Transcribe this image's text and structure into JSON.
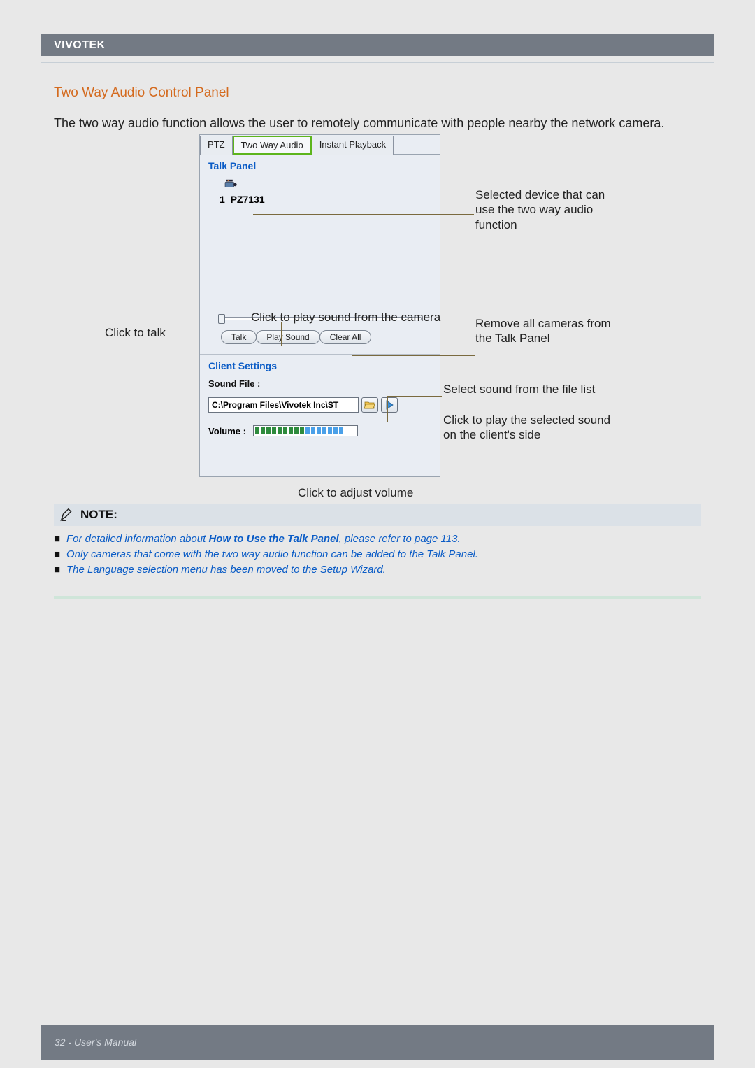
{
  "header": {
    "brand": "VIVOTEK"
  },
  "section": {
    "title": "Two Way Audio Control Panel",
    "intro": "The two way audio function allows the user to remotely communicate with people nearby the network camera."
  },
  "panel": {
    "tabs": {
      "ptz": "PTZ",
      "two_way": "Two Way Audio",
      "playback": "Instant Playback"
    },
    "talk_panel_label": "Talk Panel",
    "device_name": "1_PZ7131",
    "buttons": {
      "talk": "Talk",
      "play_sound": "Play Sound",
      "clear_all": "Clear All"
    },
    "client_settings_label": "Client Settings",
    "sound_file_label": "Sound File :",
    "sound_file_path": "C:\\Program Files\\Vivotek Inc\\ST",
    "volume_label": "Volume :"
  },
  "callouts": {
    "click_to_talk": "Click to talk",
    "click_play_camera": "Click to play sound from the camera",
    "selected_device": "Selected device that can use the two way audio function",
    "remove_all": "Remove all cameras from the Talk Panel",
    "select_sound": "Select sound from the file list",
    "click_play_selected": "Click to play the selected sound on the client's side",
    "click_adjust_vol": "Click to adjust volume"
  },
  "note": {
    "label": "NOTE:",
    "items": [
      {
        "pre": "For detailed information about ",
        "bold": "How to Use the Talk Panel",
        "post": ", please refer to page 113."
      },
      {
        "pre": "Only cameras that come with the two way audio function can be added to the Talk Panel.",
        "bold": "",
        "post": ""
      },
      {
        "pre": "The Language selection menu has been moved to the Setup Wizard.",
        "bold": "",
        "post": ""
      }
    ]
  },
  "footer": {
    "page": "32 - User's Manual"
  }
}
